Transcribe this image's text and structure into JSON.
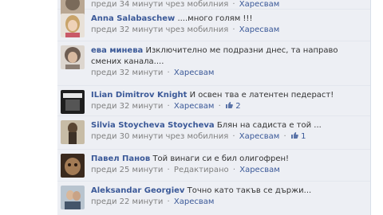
{
  "comments": [
    {
      "author": "",
      "text": "",
      "time": "преди 34 минути чрез мобилния",
      "like": "Харесвам",
      "extra": "",
      "likes": "",
      "avatar_color": "#7a6a5a"
    },
    {
      "author": "Anna Salabaschew",
      "text": "....много голям !!!",
      "time": "преди 32 минути чрез мобилния",
      "like": "Харесвам",
      "extra": "",
      "likes": "",
      "avatar_color": "#d9c1a0"
    },
    {
      "author": "ева минева",
      "text": "Изключително ме подразни днес, та направо смених канала....",
      "time": "преди 32 минути",
      "like": "Харесвам",
      "extra": "",
      "likes": "",
      "avatar_color": "#9c8f86"
    },
    {
      "author": "ILian Dimitrov Knight",
      "text": "И освен тва е латентен педераст!",
      "time": "преди 32 минути",
      "like": "Харесвам",
      "extra": "",
      "likes": "2",
      "avatar_color": "#2b2b2b"
    },
    {
      "author": "Silvia Stoycheva Stoycheva",
      "text": "Блян на садиста е той ...",
      "time": "преди 30 минути чрез мобилния",
      "like": "Харесвам",
      "extra": "",
      "likes": "1",
      "avatar_color": "#8a7a5c"
    },
    {
      "author": "Павел Панов",
      "text": "Той винаги си е бил олигофрен!",
      "time": "преди 25 минути",
      "like": "Харесвам",
      "extra": "Редактирано",
      "likes": "",
      "avatar_color": "#6b4a33"
    },
    {
      "author": "Aleksandar Georgiev",
      "text": "Точно като такъв се държи...",
      "time": "преди 22 минути",
      "like": "Харесвам",
      "extra": "",
      "likes": "",
      "avatar_color": "#8899aa"
    }
  ]
}
